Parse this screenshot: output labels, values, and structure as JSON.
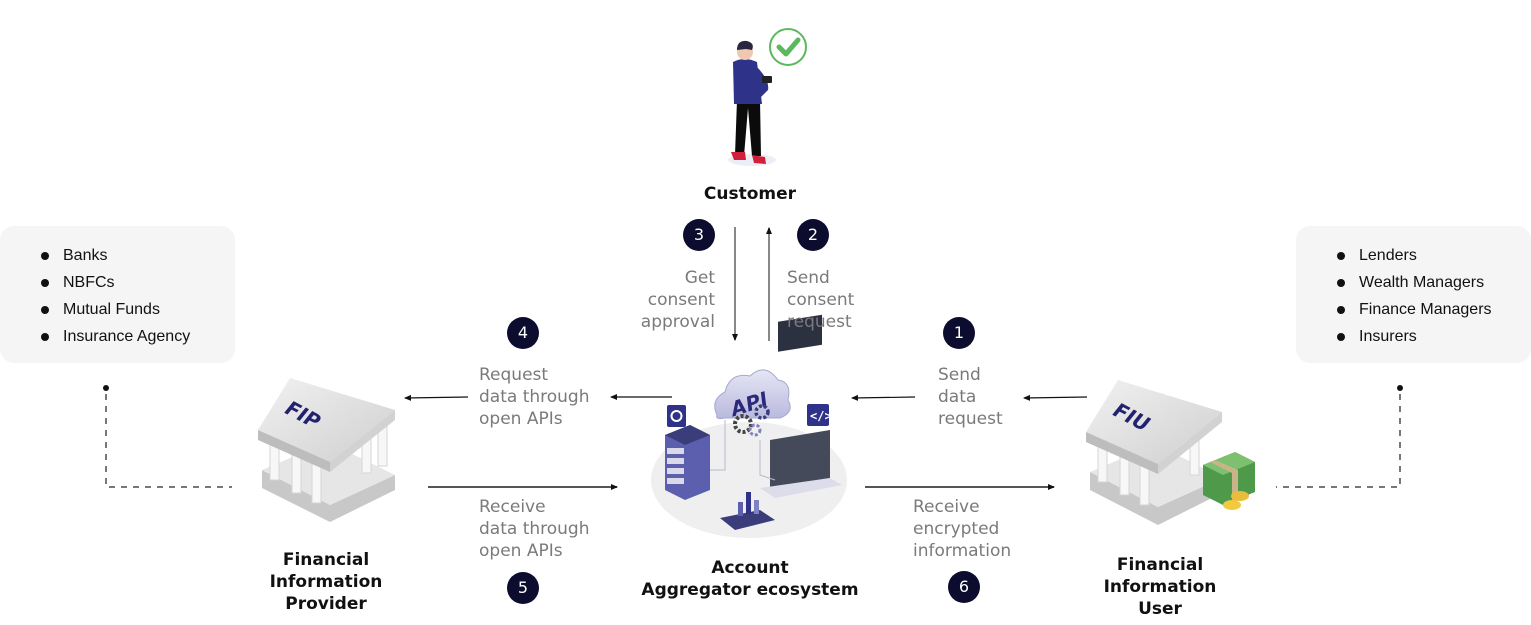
{
  "customer": {
    "label": "Customer"
  },
  "fip": {
    "label": "Financial\nInformation\nProvider",
    "building_text": "FIP",
    "list": [
      "Banks",
      "NBFCs",
      "Mutual Funds",
      "Insurance Agency"
    ]
  },
  "fiu": {
    "label": "Financial\nInformation\nUser",
    "building_text": "FIU",
    "list": [
      "Lenders",
      "Wealth Managers",
      "Finance Managers",
      "Insurers"
    ]
  },
  "aggregator": {
    "label": "Account\nAggregator ecosystem",
    "cloud_text": "API"
  },
  "steps": [
    {
      "number": "1",
      "text": "Send\ndata\nrequest"
    },
    {
      "number": "2",
      "text": "Send\nconsent\nrequest"
    },
    {
      "number": "3",
      "text": "Get\nconsent\napproval"
    },
    {
      "number": "4",
      "text": "Request\ndata through\nopen APIs"
    },
    {
      "number": "5",
      "text": "Receive\ndata through\nopen APIs"
    },
    {
      "number": "6",
      "text": "Receive\nencrypted\ninformation"
    }
  ],
  "colors": {
    "badge": "#0c0c2e",
    "check": "#5cb85c",
    "accent_blue": "#2b2a7a",
    "step_text": "#7a7a7a"
  }
}
